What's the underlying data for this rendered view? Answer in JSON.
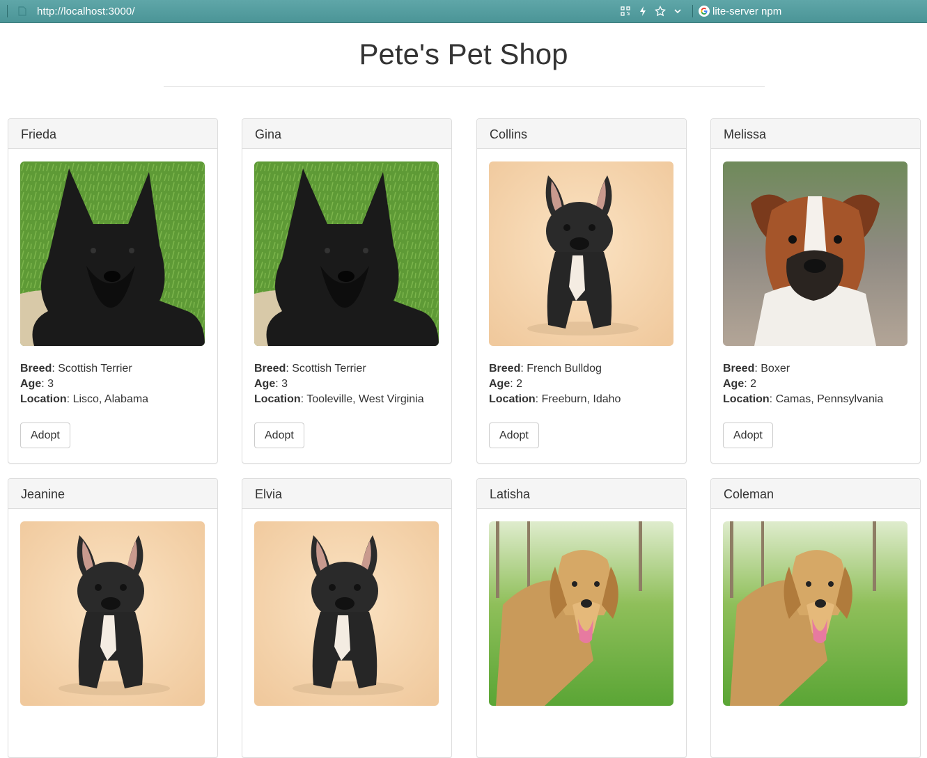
{
  "browser": {
    "url": "http://localhost:3000/",
    "search_engine_label": "lite-server npm",
    "icons": [
      "qr-code-icon",
      "lightning-icon",
      "star-icon",
      "chevron-down-icon",
      "google-icon"
    ]
  },
  "page": {
    "title": "Pete's Pet Shop"
  },
  "labels": {
    "breed": "Breed",
    "age": "Age",
    "location": "Location",
    "adopt": "Adopt"
  },
  "pets": [
    {
      "name": "Frieda",
      "breed": "Scottish Terrier",
      "age": "3",
      "location": "Lisco, Alabama",
      "image": "scottish-terrier"
    },
    {
      "name": "Gina",
      "breed": "Scottish Terrier",
      "age": "3",
      "location": "Tooleville, West Virginia",
      "image": "scottish-terrier"
    },
    {
      "name": "Collins",
      "breed": "French Bulldog",
      "age": "2",
      "location": "Freeburn, Idaho",
      "image": "french-bulldog"
    },
    {
      "name": "Melissa",
      "breed": "Boxer",
      "age": "2",
      "location": "Camas, Pennsylvania",
      "image": "boxer"
    },
    {
      "name": "Jeanine",
      "image": "french-bulldog"
    },
    {
      "name": "Elvia",
      "image": "french-bulldog"
    },
    {
      "name": "Latisha",
      "image": "golden-retriever"
    },
    {
      "name": "Coleman",
      "image": "golden-retriever"
    }
  ],
  "colors": {
    "browser_bar": "#5fa6a8",
    "panel_heading_bg": "#f5f5f5",
    "panel_border": "#dddddd",
    "text": "#333333"
  }
}
